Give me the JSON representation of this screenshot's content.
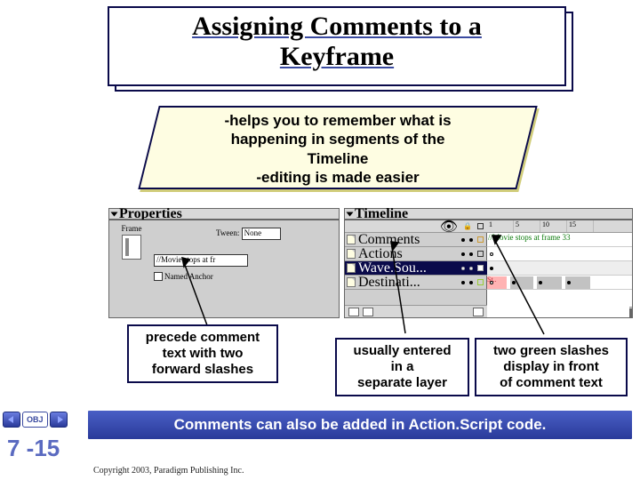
{
  "title_l1": "Assigning Comments to a",
  "title_l2": "Keyframe",
  "notes_l1": "-helps you to remember what is",
  "notes_l2": "happening in segments of the",
  "notes_l3": "Timeline",
  "notes_l4": "-editing is made easier",
  "props": {
    "title": "Properties",
    "frame_label": "Frame",
    "tween_label": "Tween:",
    "tween_value": "None",
    "comment_value": "//Movie stops at fr",
    "anchor_label": "Named Anchor"
  },
  "timeline": {
    "title": "Timeline",
    "ruler": [
      "1",
      "5",
      "10",
      "15"
    ],
    "layers": {
      "comments": "Comments",
      "actions": "Actions",
      "wavesound": "Wave.Sou...",
      "destination": "Destinati..."
    },
    "comment_flag": "//Movie stops at frame 33",
    "st_flag": "St.."
  },
  "cap1_l1": "precede comment",
  "cap1_l2": "text with two",
  "cap1_l3": "forward slashes",
  "cap2_l1": "usually entered",
  "cap2_l2": "in a",
  "cap2_l3": "separate layer",
  "cap3_l1": "two green slashes",
  "cap3_l2": "display in front",
  "cap3_l3": "of comment text",
  "footer": "Comments can also be added in Action.Script code.",
  "nav_obj": "OBJ",
  "page_num": "7 -15",
  "copyright": "Copyright 2003, Paradigm Publishing Inc."
}
